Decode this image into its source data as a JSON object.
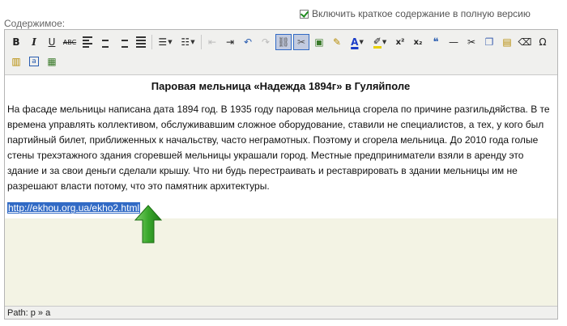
{
  "header": {
    "include_summary": {
      "label": "Включить краткое содержание в полную версию",
      "checked": true
    },
    "content_label": "Содержимое:"
  },
  "toolbar": {
    "row1": [
      {
        "name": "bold-icon",
        "glyph": "B"
      },
      {
        "name": "italic-icon",
        "glyph": "I"
      },
      {
        "name": "underline-icon",
        "glyph": "U"
      },
      {
        "name": "strikethrough-icon",
        "glyph": "ABC"
      },
      {
        "name": "align-left-icon",
        "glyph": ""
      },
      {
        "name": "align-center-icon",
        "glyph": ""
      },
      {
        "name": "align-right-icon",
        "glyph": ""
      },
      {
        "name": "align-justify-icon",
        "glyph": ""
      },
      {
        "name": "bullet-list-icon",
        "glyph": "☰"
      },
      {
        "name": "numbered-list-icon",
        "glyph": "☷"
      },
      {
        "name": "outdent-icon",
        "glyph": "⇤"
      },
      {
        "name": "indent-icon",
        "glyph": "⇥"
      },
      {
        "name": "undo-icon",
        "glyph": "↶"
      },
      {
        "name": "redo-icon",
        "glyph": "↷"
      },
      {
        "name": "link-icon",
        "glyph": "⛓"
      },
      {
        "name": "unlink-icon",
        "glyph": "✂"
      },
      {
        "name": "image-icon",
        "glyph": "▣"
      },
      {
        "name": "cleanup-icon",
        "glyph": "✎"
      },
      {
        "name": "text-color-icon",
        "glyph": "A"
      },
      {
        "name": "background-color-icon",
        "glyph": "✐"
      },
      {
        "name": "superscript-icon",
        "glyph": "x²"
      },
      {
        "name": "subscript-icon",
        "glyph": "x₂"
      },
      {
        "name": "blockquote-icon",
        "glyph": "❝"
      },
      {
        "name": "horizontal-rule-icon",
        "glyph": "—"
      },
      {
        "name": "cut-icon",
        "glyph": "✂"
      },
      {
        "name": "copy-icon",
        "glyph": "❐"
      },
      {
        "name": "paste-icon",
        "glyph": "▤"
      },
      {
        "name": "eraser-icon",
        "glyph": "⌫"
      },
      {
        "name": "special-char-icon",
        "glyph": "Ω"
      }
    ],
    "row2": [
      {
        "name": "paste-text-icon",
        "glyph": "▥"
      },
      {
        "name": "select-all-icon",
        "glyph": "a"
      },
      {
        "name": "media-icon",
        "glyph": "▦"
      }
    ]
  },
  "document": {
    "title": "Паровая мельница «Надежда 1894г» в Гуляйполе",
    "paragraph": "На фасаде мельницы написана дата 1894 год. В 1935 году паровая мельница сгорела по причине разгильдяйства. В те времена управлять коллективом, обслуживавшим сложное оборудование, ставили не специалистов, а тех, у кого был партийный билет, приближенных к начальству, часто неграмотных. Поэтому и сгорела мельница. До 2010 года голые стены трехэтажного здания сгоревшей мельницы украшали город. Местные предприниматели взяли в аренду это здание и за свои деньги сделали крышу. Что ни будь перестраивать и реставрировать в здании мельницы им не разрешают власти потому, что это памятник архитектуры.",
    "link": "http://ekhou.org.ua/ekho2.html"
  },
  "status_bar": {
    "path": "Path: p » a"
  },
  "colors": {
    "selection": "#316ac5",
    "arrow": "#2e9b22",
    "editor_bg": "#f3f3e4"
  }
}
